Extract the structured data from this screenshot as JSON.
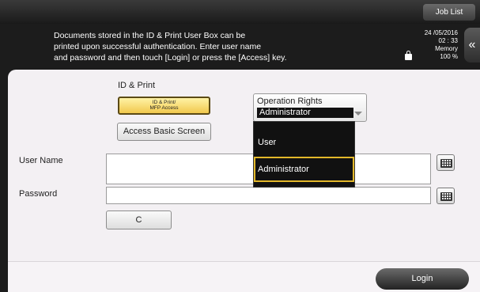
{
  "header": {
    "job_list": "Job List",
    "message": "Documents stored in the ID & Print User Box can be\nprinted upon successful authentication. Enter user name\nand password and then touch [Login] or press the [Access] key.",
    "date": "24 /05/2016",
    "time": "02 : 33",
    "memory_label": "Memory",
    "memory_value": "100 %"
  },
  "form": {
    "section_title": "ID & Print",
    "id_print_button": "ID & Print/\nMFP Access",
    "access_basic_button": "Access Basic Screen",
    "operation_rights_label": "Operation Rights",
    "operation_rights_value": "Administrator",
    "operation_rights_options": [
      "User",
      "Administrator"
    ],
    "user_name_label": "User Name",
    "user_name_value": "",
    "password_label": "Password",
    "password_value": "",
    "clear_button": "C"
  },
  "footer": {
    "login_button": "Login"
  }
}
